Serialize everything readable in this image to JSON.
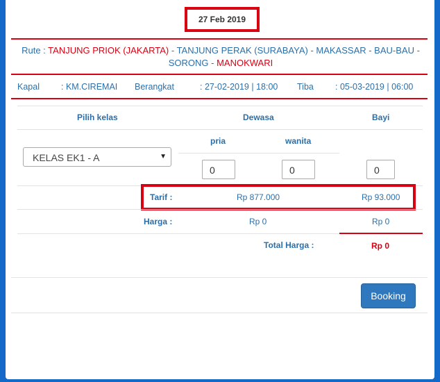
{
  "date": "27 Feb 2019",
  "route": {
    "label": "Rute :",
    "stops": [
      {
        "text": "TANJUNG PRIOK (JAKARTA)",
        "highlight": true
      },
      {
        "text": " - ",
        "highlight": false
      },
      {
        "text": "TANJUNG PERAK (SURABAYA) - MAKASSAR - BAU-BAU -",
        "highlight": false
      }
    ],
    "line2": [
      {
        "text": "SORONG - ",
        "highlight": false
      },
      {
        "text": "MANOKWARI",
        "highlight": true
      }
    ]
  },
  "info": {
    "kapal_label": "Kapal",
    "kapal_value": ": KM.CIREMAI",
    "berangkat_label": "Berangkat",
    "berangkat_value": ": 27-02-2019 | 18:00",
    "tiba_label": "Tiba",
    "tiba_value": ": 05-03-2019 | 06:00"
  },
  "table": {
    "col_class": "Pilih kelas",
    "col_adult": "Dewasa",
    "col_infant": "Bayi",
    "sub_male": "pria",
    "sub_female": "wanita",
    "selected_class": "KELAS EK1 - A",
    "qty_male": "0",
    "qty_female": "0",
    "qty_infant": "0"
  },
  "tarif": {
    "label": "Tarif :",
    "adult": "Rp 877.000",
    "infant": "Rp 93.000"
  },
  "harga": {
    "label": "Harga :",
    "adult": "Rp 0",
    "infant": "Rp 0"
  },
  "total": {
    "label": "Total Harga :",
    "value": "Rp 0"
  },
  "booking_label": "Booking",
  "colors": {
    "accent_red": "#d90012",
    "text_blue": "#2c6fa8",
    "button_blue": "#2f78bd",
    "background_blue": "#1468c8"
  }
}
